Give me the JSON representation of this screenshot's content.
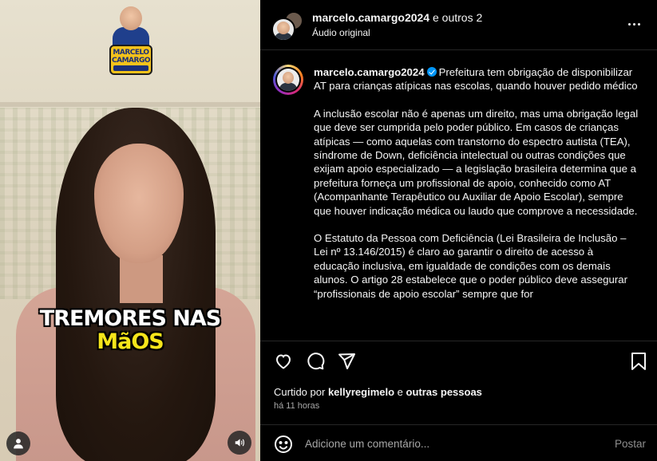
{
  "video": {
    "caption_line1": "TREMORES NAS",
    "caption_line2": "MãOS",
    "logo": {
      "line1": "MARCELO",
      "line2": "CAMARGO",
      "line3": "A VOZ DO POVO"
    },
    "icons": {
      "user": "user-icon",
      "audio": "volume-icon"
    }
  },
  "header": {
    "username": "marcelo.camargo2024",
    "and_others": "e outros 2",
    "audio": "Áudio original",
    "more_icon": "more-horizontal-icon"
  },
  "post": {
    "username": "marcelo.camargo2024",
    "verified_icon": "verified-badge-icon",
    "headline": "Prefeitura tem obrigação de disponibilizar AT para crianças atípicas nas escolas, quando houver pedido médico",
    "paragraphs": [
      "A inclusão escolar não é apenas um direito, mas uma obrigação legal que deve ser cumprida pelo poder público. Em casos de crianças atípicas — como aquelas com transtorno do espectro autista (TEA), síndrome de Down, deficiência intelectual ou outras condições que exijam apoio especializado — a legislação brasileira determina que a prefeitura forneça um profissional de apoio, conhecido como AT (Acompanhante Terapêutico ou Auxiliar de Apoio Escolar), sempre que houver indicação médica ou laudo que comprove a necessidade.",
      "O Estatuto da Pessoa com Deficiência (Lei Brasileira de Inclusão – Lei nº 13.146/2015) é claro ao garantir o direito de acesso à educação inclusiva, em igualdade de condições com os demais alunos. O artigo 28 estabelece que o poder público deve assegurar “profissionais de apoio escolar” sempre que for"
    ]
  },
  "actions": {
    "like": "heart-icon",
    "comment": "comment-icon",
    "share": "send-icon",
    "save": "bookmark-icon"
  },
  "likes": {
    "prefix": "Curtido por",
    "user": "kellyregimelo",
    "connector": "e",
    "others": "outras pessoas"
  },
  "timestamp": "há 11 horas",
  "comment": {
    "emoji_icon": "emoji-icon",
    "placeholder": "Adicione um comentário...",
    "post_label": "Postar"
  },
  "colors": {
    "background": "#000000",
    "text": "#f5f5f5",
    "muted": "#a8a8a8",
    "verified": "#0095f6",
    "caption_yellow": "#f6e51a"
  }
}
